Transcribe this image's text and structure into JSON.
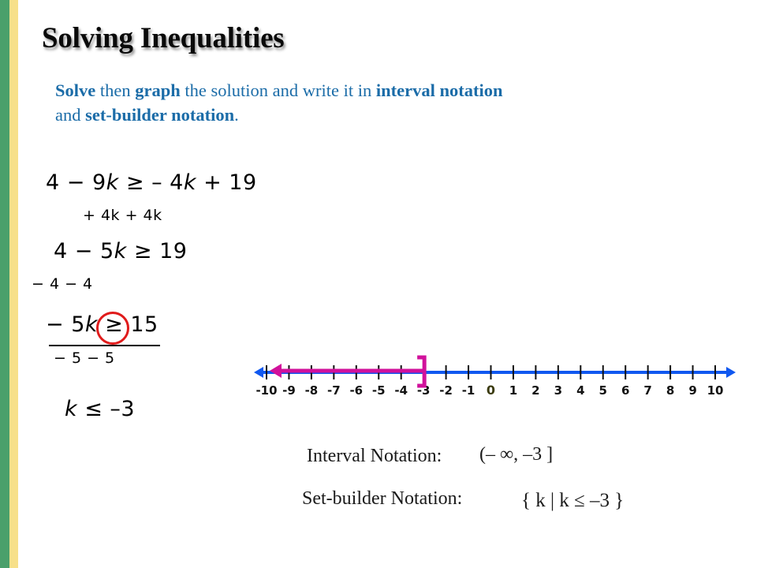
{
  "slide": {
    "title": "Solving Inequalities",
    "accent_green": "#4aa06b",
    "accent_yellow": "#f7e08a",
    "subtitle_color": "#1b6ca8",
    "highlight_color": "#e01b1b"
  },
  "subtitle": {
    "part1_bold": "Solve",
    "part2": " then ",
    "part3_bold": "graph",
    "part4": " the solution and write it in ",
    "part5_bold": "interval notation",
    "part6": "and ",
    "part7_bold": "set-builder notation",
    "part8": "."
  },
  "work": {
    "step1": "4 − 9k  ≥  –4k + 19",
    "step1_left": "4 − 9",
    "step1_var": "k",
    "step1_rel": " ≥ – 4",
    "step1_var2": "k",
    "step1_tail": " + 19",
    "step1_operation": "+ 4k      + 4k",
    "step2_left": "4 − 5",
    "step2_var": "k",
    "step2_tail": " ≥ 19",
    "step2_operation": "− 4             − 4",
    "step3_left": "− 5",
    "step3_var": "k",
    "step3_tail": " ≥ 15",
    "step3_operation": "− 5      − 5",
    "step4_var": "k",
    "step4_tail": " ≤ –3",
    "circled_symbol": "≥"
  },
  "number_line": {
    "min": -10,
    "max": 10,
    "tick_labels": [
      "-10",
      "-9",
      "-8",
      "-7",
      "-6",
      "-5",
      "-4",
      "-3",
      "-2",
      "-1",
      "0",
      "1",
      "2",
      "3",
      "4",
      "5",
      "6",
      "7",
      "8",
      "9",
      "10"
    ],
    "zero_label": "0",
    "axis_color": "#1058f0",
    "solution_color": "#d1119b",
    "zero_color": "#3b3b10",
    "bracket_at": -3,
    "bracket_type": "closed-right",
    "ray_direction": "left"
  },
  "notations": {
    "interval_label": "Interval Notation:",
    "interval_value": "(– ∞, –3 ]",
    "setbuilder_label": "Set-builder Notation:",
    "setbuilder_value": "{ k | k ≤ –3 }"
  }
}
